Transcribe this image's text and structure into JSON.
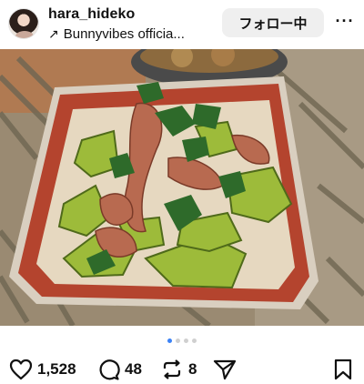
{
  "post": {
    "username": "hara_hideko",
    "subline": "Bunnyvibes officia...",
    "follow_label": "フォロー中",
    "more_label": "···"
  },
  "carousel": {
    "total": 4,
    "active": 0
  },
  "actions": {
    "likes": "1,528",
    "comments": "48",
    "reposts": "8"
  },
  "icons": {
    "subline": "arrow-up-right-icon",
    "like": "heart-icon",
    "comment": "comment-bubble-icon",
    "repost": "repost-icon",
    "share": "paper-plane-icon",
    "save": "bookmark-icon",
    "sound": "speaker-icon"
  },
  "colors": {
    "accent": "#3b82f6",
    "follow_bg": "#efefef"
  }
}
